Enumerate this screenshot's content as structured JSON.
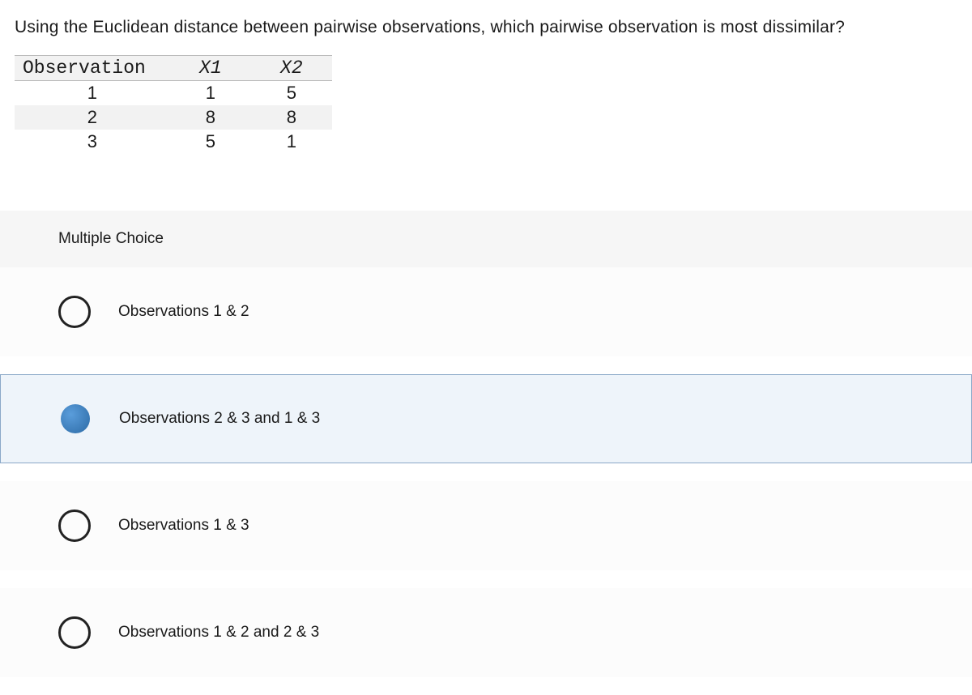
{
  "question": "Using the Euclidean distance between pairwise observations, which pairwise observation is most dissimilar?",
  "table": {
    "headers": [
      "Observation",
      "X1",
      "X2"
    ],
    "rows": [
      {
        "obs": "1",
        "x1": "1",
        "x2": "5"
      },
      {
        "obs": "2",
        "x1": "8",
        "x2": "8"
      },
      {
        "obs": "3",
        "x1": "5",
        "x2": "1"
      }
    ]
  },
  "section_label": "Multiple Choice",
  "choices": [
    {
      "label": "Observations 1 & 2",
      "selected": false
    },
    {
      "label": "Observations 2 & 3 and 1 & 3",
      "selected": true
    },
    {
      "label": "Observations 1 & 3",
      "selected": false
    },
    {
      "label": "Observations 1 & 2 and 2 & 3",
      "selected": false
    }
  ]
}
